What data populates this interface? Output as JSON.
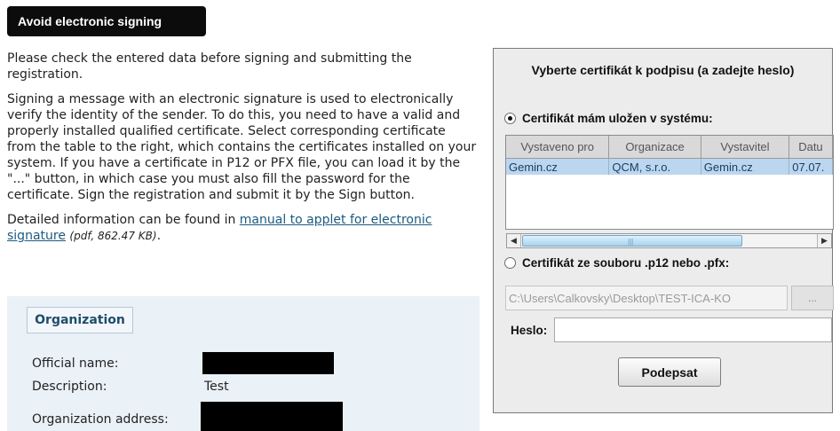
{
  "top_button": {
    "label": "Avoid electronic signing"
  },
  "intro": {
    "p1": "Please check the entered data before signing and submitting the registration.",
    "p2": "Signing a message with an electronic signature is used to electronically verify the identity of the sender. To do this, you need to have a valid and properly installed qualified certificate. Select corresponding certificate from the table to the right, which contains the certificates installed on your system. If you have a certificate in P12 or PFX file, you can load it by the \"...\" button, in which case you must also fill the password for the certificate. Sign the registration and submit it by the Sign button.",
    "p3_prefix": "Detailed information can be found in ",
    "p3_link": "manual to applet for electronic signature",
    "p3_meta": "(pdf, 862.47 KB)",
    "p3_suffix": "."
  },
  "organization": {
    "tab_label": "Organization",
    "official_name_label": "Official name:",
    "description_label": "Description:",
    "description_value": "Test",
    "address_label": "Organization address:"
  },
  "applet": {
    "title": "Vyberte certifikát k podpisu (a zadejte heslo)",
    "option_system": "Certifikát mám uložen v systému:",
    "option_file": "Certifikát ze souboru .p12 nebo .pfx:",
    "table": {
      "columns": [
        "Vystaveno pro",
        "Organizace",
        "Vystavitel",
        "Datu"
      ],
      "rows": [
        [
          "Gemin.cz",
          "QCM, s.r.o.",
          "Gemin.cz",
          "07.07."
        ]
      ]
    },
    "file_path": "C:\\Users\\Calkovsky\\Desktop\\TEST-ICA-KO",
    "browse_label": "...",
    "password_label": "Heslo:",
    "password_value": "",
    "sign_label": "Podepsat"
  }
}
